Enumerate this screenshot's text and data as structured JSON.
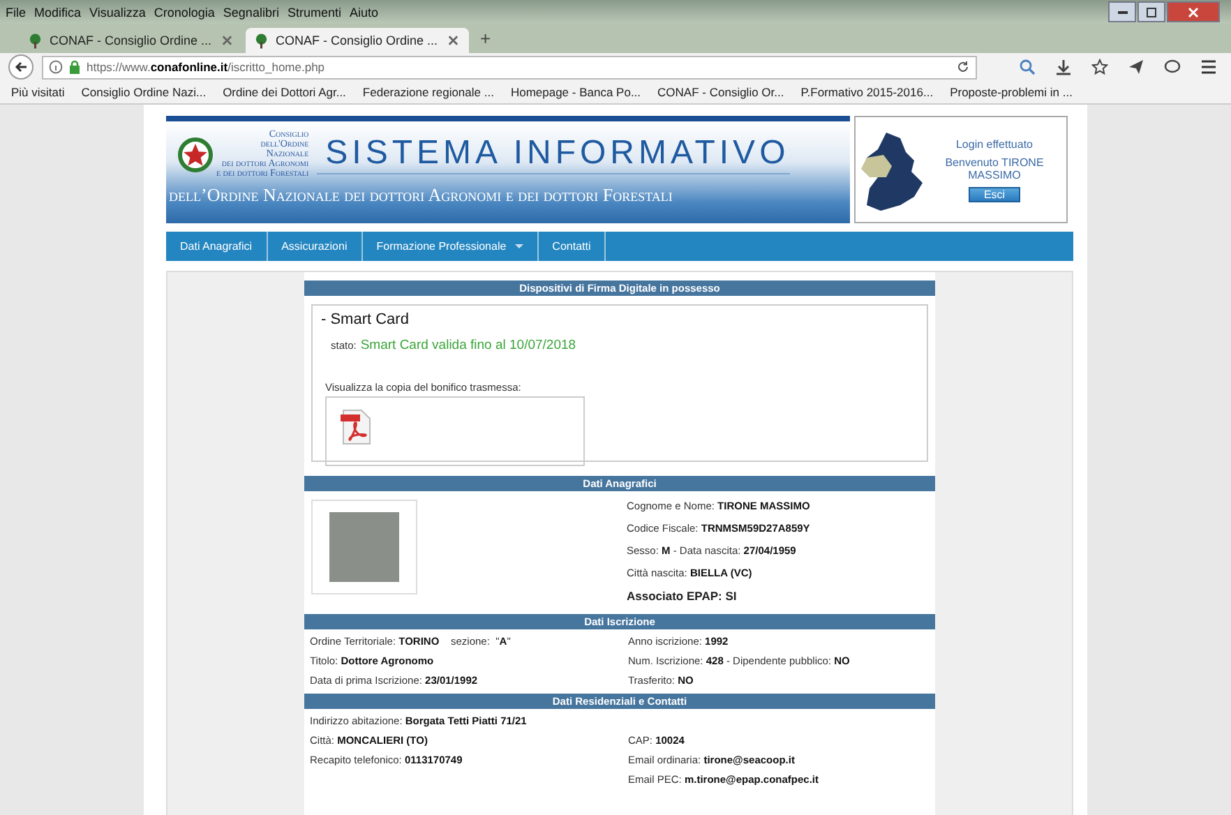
{
  "menu_bar": [
    "File",
    "Modifica",
    "Visualizza",
    "Cronologia",
    "Segnalibri",
    "Strumenti",
    "Aiuto"
  ],
  "browser_tabs": [
    {
      "label": "CONAF - Consiglio Ordine ...",
      "selected": false
    },
    {
      "label": "CONAF - Consiglio Ordine ...",
      "selected": true
    }
  ],
  "new_tab": "+",
  "address_bar": {
    "url": "https://www.**conafonline.it**/iscritto_home.php"
  },
  "bookmarks": [
    "Più visitati",
    "Consiglio Ordine Nazi...",
    "Ordine dei Dottori Agr...",
    "Federazione regionale ...",
    "Homepage - Banca Po...",
    "CONAF - Consiglio Or...",
    "P.Formativo 2015-2016...",
    "Proposte-problemi in ..."
  ],
  "header": {
    "logo_lines": [
      "Consiglio",
      "dell'Ordine",
      "Nazionale",
      "dei dottori Agronomi",
      "e dei dottori Forestali"
    ],
    "title": "SISTEMA INFORMATIVO",
    "subtitle": "dell’Ordine Nazionale dei dottori Agronomi e dei dottori Forestali"
  },
  "login": {
    "status": "Login effettuato",
    "welcome": "Benvenuto TIRONE MASSIMO",
    "button": "Esci"
  },
  "nav": [
    {
      "label": "Dati Anagrafici",
      "dropdown": false
    },
    {
      "label": "Assicurazioni",
      "dropdown": false
    },
    {
      "label": "Formazione Professionale",
      "dropdown": true
    },
    {
      "label": "Contatti",
      "dropdown": false
    }
  ],
  "firma": {
    "title": "Dispositivi di Firma Digitale in possesso",
    "card_title": "- Smart Card",
    "status_label": "stato:",
    "status_value": "Smart Card valida fino al 10/07/2018",
    "attachment_label": "Visualizza la copia del bonifico trasmessa:"
  },
  "anagrafici": {
    "title": "Dati Anagrafici",
    "fields": [
      "Cognome e Nome: **TIRONE MASSIMO**",
      "Codice Fiscale: **TRNMSM59D27A859Y**",
      "Sesso: **M** - Data nascita: **27/04/1959**",
      "Città nascita: **BIELLA (VC)**"
    ],
    "epap": "Associato EPAP: SI"
  },
  "iscrizione": {
    "title": "Dati Iscrizione",
    "rows": [
      [
        "Ordine Territoriale: **TORINO**    sezione:  \"**A**\"",
        "Anno iscrizione: **1992**"
      ],
      [
        "Titolo: **Dottore Agronomo**",
        "Num. Iscrizione: **428** - Dipendente pubblico: **NO**"
      ],
      [
        "Data di prima Iscrizione: **23/01/1992**",
        "Trasferito: **NO**"
      ]
    ]
  },
  "residenza": {
    "title": "Dati Residenziali e Contatti",
    "rows": [
      [
        "Indirizzo abitazione: **Borgata Tetti Piatti 71/21**",
        ""
      ],
      [
        "Città: **MONCALIERI (TO)**",
        "CAP: **10024**"
      ],
      [
        "Recapito telefonico: **0113170749**",
        "Email ordinaria: **tirone@seacoop.it**"
      ],
      [
        "",
        "Email PEC: **m.tirone@epap.conafpec.it**"
      ]
    ]
  }
}
